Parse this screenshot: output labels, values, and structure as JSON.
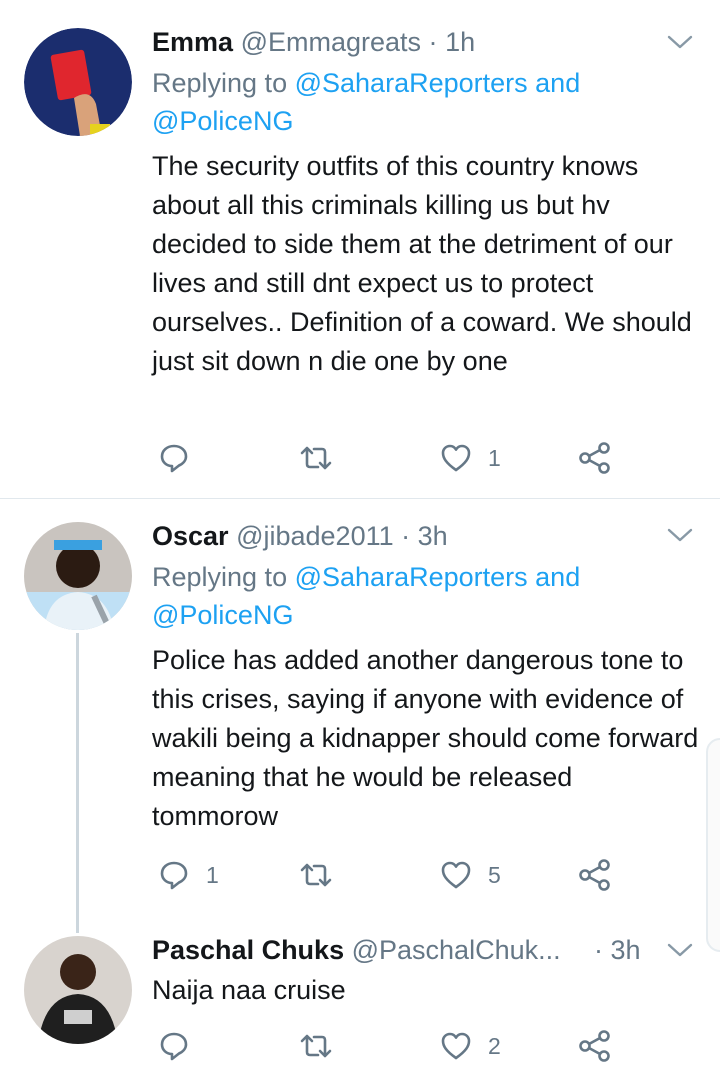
{
  "tweets": [
    {
      "name": "Emma",
      "handle": "@Emmagreats",
      "sep": "·",
      "time": "1h",
      "replying_prefix": "Replying to",
      "mention1": "@SaharaReporters",
      "and": "and",
      "mention2": "@PoliceNG",
      "text": "The security outfits of this country knows about all this criminals killing us but hv decided to side them at the detriment of our lives and still dnt expect us to protect ourselves.. Definition of a coward. We should just sit down n die one by one",
      "reply_count": "",
      "retweet_count": "",
      "like_count": "1",
      "avatar_icon": "red-card-avatar"
    },
    {
      "name": "Oscar",
      "handle": "@jibade2011",
      "sep": "·",
      "time": "3h",
      "replying_prefix": "Replying to",
      "mention1": "@SaharaReporters",
      "and": "and",
      "mention2": "@PoliceNG",
      "text": "Police has added another dangerous tone to this crises, saying if anyone with evidence of wakili being a kidnapper should come forward meaning that he would be released tommorow",
      "reply_count": "1",
      "retweet_count": "",
      "like_count": "5",
      "avatar_icon": "person-avatar"
    },
    {
      "name": "Paschal Chuks",
      "handle": "@PaschalChuk...",
      "sep": "·",
      "time": "3h",
      "text": "Naija naa cruise",
      "reply_count": "",
      "retweet_count": "",
      "like_count": "2",
      "avatar_icon": "person-avatar"
    }
  ],
  "colors": {
    "link": "#1da1f2",
    "secondary_text": "#657786",
    "icon": "#657786",
    "divider": "#e1e8ed"
  }
}
